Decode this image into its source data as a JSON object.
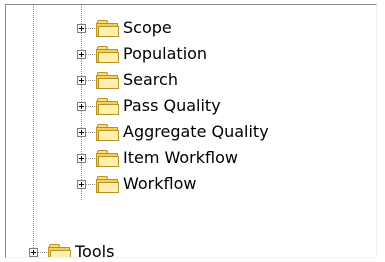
{
  "tree": {
    "children": [
      {
        "label": "Scope",
        "icon": "folder-icon",
        "expander": "plus"
      },
      {
        "label": "Population",
        "icon": "folder-icon",
        "expander": "plus"
      },
      {
        "label": "Search",
        "icon": "folder-icon",
        "expander": "plus"
      },
      {
        "label": "Pass Quality",
        "icon": "folder-icon",
        "expander": "plus"
      },
      {
        "label": "Aggregate Quality",
        "icon": "folder-icon",
        "expander": "plus"
      },
      {
        "label": "Item Workflow",
        "icon": "folder-icon",
        "expander": "plus"
      },
      {
        "label": "Workflow",
        "icon": "folder-icon",
        "expander": "plus"
      }
    ],
    "sibling": {
      "label": "Tools",
      "icon": "folder-icon",
      "expander": "plus"
    }
  }
}
